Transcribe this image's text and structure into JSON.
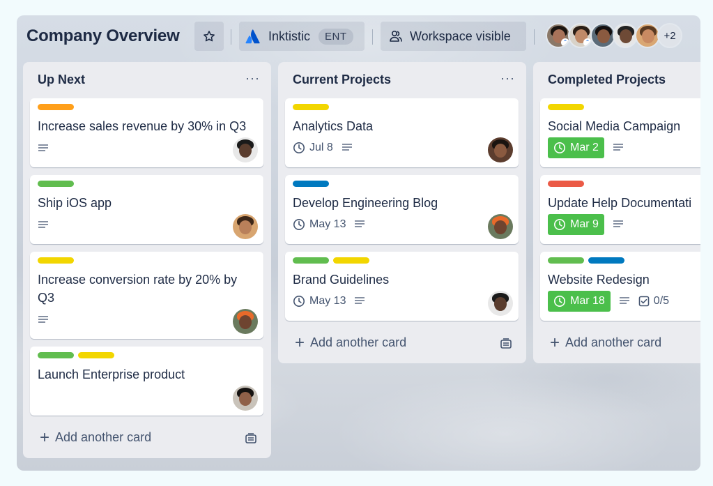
{
  "board": {
    "title": "Company Overview",
    "workspace_name": "Inktistic",
    "workspace_badge": "ENT",
    "visibility_label": "Workspace visible",
    "members_extra": "+2"
  },
  "icons": {
    "star": "star-icon",
    "visibility": "users-icon",
    "description": "description-icon",
    "clock": "clock-icon",
    "checklist": "checklist-icon",
    "template": "template-icon"
  },
  "colors": {
    "orange": "#ff9f1a",
    "green": "#61bd4f",
    "yellow": "#f2d600",
    "blue": "#0079bf",
    "red": "#eb5a46",
    "due_complete": "#4bbf4b"
  },
  "lists": [
    {
      "title": "Up Next",
      "menu": "···",
      "add_label": "Add another card",
      "cards": [
        {
          "title": "Increase sales revenue by 30% in Q3",
          "labels": [
            "orange"
          ]
        },
        {
          "title": "Ship iOS app",
          "labels": [
            "green"
          ]
        },
        {
          "title": "Increase conversion rate by 20% by Q3",
          "labels": [
            "yellow"
          ]
        },
        {
          "title": "Launch Enterprise product",
          "labels": [
            "green",
            "yellow"
          ]
        }
      ]
    },
    {
      "title": "Current Projects",
      "menu": "···",
      "add_label": "Add another card",
      "cards": [
        {
          "title": "Analytics Data",
          "labels": [
            "yellow"
          ],
          "due": "Jul 8"
        },
        {
          "title": "Develop Engineering Blog",
          "labels": [
            "blue"
          ],
          "due": "May 13"
        },
        {
          "title": "Brand Guidelines",
          "labels": [
            "green",
            "yellow"
          ],
          "due": "May 13"
        }
      ]
    },
    {
      "title": "Completed Projects",
      "add_label": "Add another card",
      "cards": [
        {
          "title": "Social Media Campaign",
          "labels": [
            "yellow"
          ],
          "due": "Mar 2"
        },
        {
          "title": "Update Help Documentati",
          "labels": [
            "red"
          ],
          "due": "Mar 9"
        },
        {
          "title": "Website Redesign",
          "labels": [
            "green",
            "blue"
          ],
          "due": "Mar 18",
          "checklist": "0/5"
        }
      ]
    }
  ]
}
